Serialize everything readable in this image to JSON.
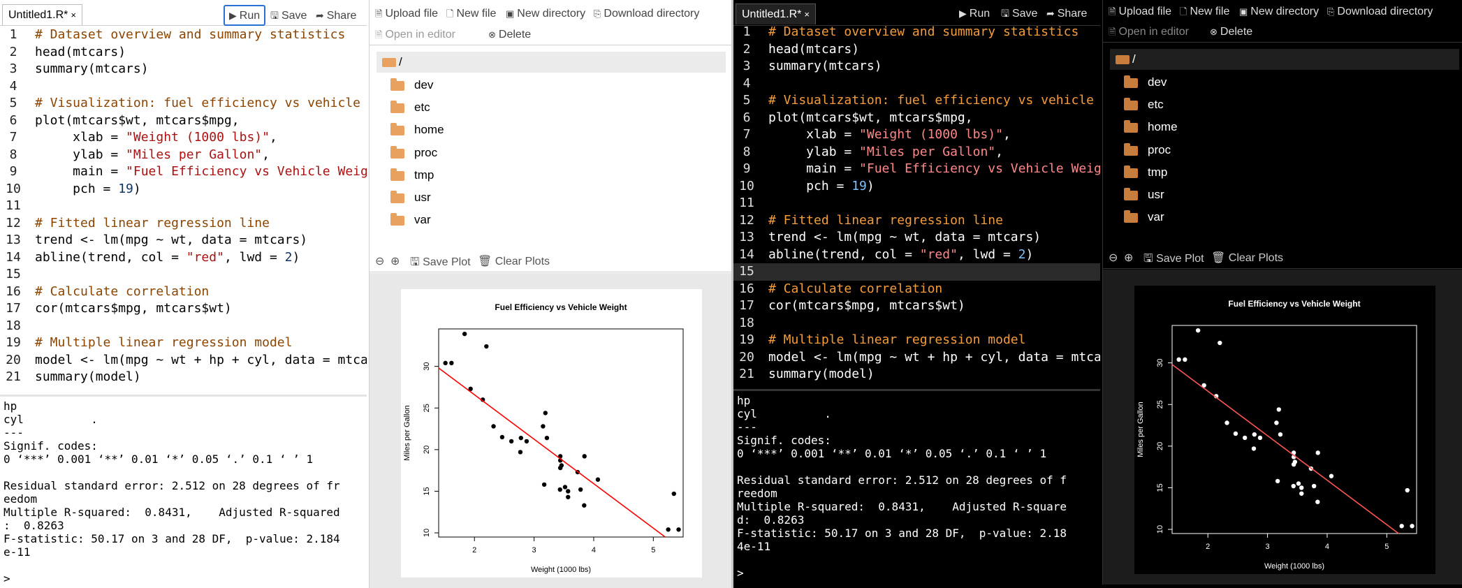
{
  "editor": {
    "tab_label": "Untitled1.R*",
    "tab_close": "×",
    "run_label": "Run",
    "save_label": "Save",
    "share_label": "Share",
    "lines": [
      [
        {
          "t": "# Dataset overview and summary statistics",
          "k": "com"
        }
      ],
      [
        {
          "t": "head(mtcars)"
        }
      ],
      [
        {
          "t": "summary(mtcars)"
        }
      ],
      [
        {
          "t": ""
        }
      ],
      [
        {
          "t": "# Visualization: fuel efficiency vs vehicle weight",
          "k": "com"
        }
      ],
      [
        {
          "t": "plot(mtcars$wt, mtcars$mpg,"
        }
      ],
      [
        {
          "t": "     xlab = "
        },
        {
          "t": "\"Weight (1000 lbs)\"",
          "k": "str"
        },
        {
          "t": ","
        }
      ],
      [
        {
          "t": "     ylab = "
        },
        {
          "t": "\"Miles per Gallon\"",
          "k": "str"
        },
        {
          "t": ","
        }
      ],
      [
        {
          "t": "     main = "
        },
        {
          "t": "\"Fuel Efficiency vs Vehicle Weight\"",
          "k": "str"
        },
        {
          "t": ","
        }
      ],
      [
        {
          "t": "     pch = "
        },
        {
          "t": "19",
          "k": "num"
        },
        {
          "t": ")"
        }
      ],
      [
        {
          "t": ""
        }
      ],
      [
        {
          "t": "# Fitted linear regression line",
          "k": "com"
        }
      ],
      [
        {
          "t": "trend <- lm(mpg ~ wt, data = mtcars)"
        }
      ],
      [
        {
          "t": "abline(trend, col = "
        },
        {
          "t": "\"red\"",
          "k": "str"
        },
        {
          "t": ", lwd = "
        },
        {
          "t": "2",
          "k": "num"
        },
        {
          "t": ")"
        }
      ],
      [
        {
          "t": ""
        }
      ],
      [
        {
          "t": "# Calculate correlation",
          "k": "com"
        }
      ],
      [
        {
          "t": "cor(mtcars$mpg, mtcars$wt)"
        }
      ],
      [
        {
          "t": ""
        }
      ],
      [
        {
          "t": "# Multiple linear regression model",
          "k": "com"
        }
      ],
      [
        {
          "t": "model <- lm(mpg ~ wt + hp + cyl, data = mtcars)"
        }
      ],
      [
        {
          "t": "summary(model)"
        }
      ]
    ]
  },
  "console_light": {
    "lines": [
      "hp",
      "cyl          .",
      "---",
      "Signif. codes:",
      "0 ‘***’ 0.001 ‘**’ 0.01 ‘*’ 0.05 ‘.’ 0.1 ‘ ’ 1",
      "",
      "Residual standard error: 2.512 on 28 degrees of fr",
      "eedom",
      "Multiple R-squared:  0.8431,    Adjusted R-squared",
      ":  0.8263",
      "F-statistic: 50.17 on 3 and 28 DF,  p-value: 2.184",
      "e-11",
      "",
      ">"
    ]
  },
  "console_dark": {
    "lines": [
      "hp",
      "cyl          .",
      "---",
      "Signif. codes:",
      "0 ‘***’ 0.001 ‘**’ 0.01 ‘*’ 0.05 ‘.’ 0.1 ‘ ’ 1",
      "",
      "Residual standard error: 2.512 on 28 degrees of f",
      "reedom",
      "Multiple R-squared:  0.8431,    Adjusted R-square",
      "d:  0.8263",
      "F-statistic: 50.17 on 3 and 28 DF,  p-value: 2.18",
      "4e-11",
      "",
      ">"
    ]
  },
  "files": {
    "upload_label": "Upload file",
    "new_file_label": "New file",
    "new_dir_label": "New directory",
    "download_dir_label": "Download directory",
    "open_editor_label": "Open in editor",
    "delete_label": "Delete",
    "root": "/",
    "folders": [
      "dev",
      "etc",
      "home",
      "proc",
      "tmp",
      "usr",
      "var"
    ]
  },
  "plots": {
    "save_label": "Save Plot",
    "clear_label": "Clear Plots"
  },
  "colors": {
    "light_bg": "#ffffff",
    "dark_bg": "#000000",
    "accent": "#2a6fd6",
    "regression_line": "#ff0000",
    "folder": "#e8a15e"
  },
  "chart_data": {
    "type": "scatter",
    "title": "Fuel Efficiency vs Vehicle Weight",
    "xlabel": "Weight (1000 lbs)",
    "ylabel": "Miles per Gallon",
    "xlim": [
      1.4,
      5.5
    ],
    "ylim": [
      9.5,
      34.5
    ],
    "xticks": [
      2,
      3,
      4,
      5
    ],
    "yticks": [
      10,
      15,
      20,
      25,
      30
    ],
    "points": [
      [
        2.62,
        21.0
      ],
      [
        2.875,
        21.0
      ],
      [
        2.32,
        22.8
      ],
      [
        3.215,
        21.4
      ],
      [
        3.44,
        18.7
      ],
      [
        3.46,
        18.1
      ],
      [
        3.57,
        14.3
      ],
      [
        3.19,
        24.4
      ],
      [
        3.15,
        22.8
      ],
      [
        3.44,
        19.2
      ],
      [
        3.44,
        17.8
      ],
      [
        4.07,
        16.4
      ],
      [
        3.73,
        17.3
      ],
      [
        3.78,
        15.2
      ],
      [
        5.25,
        10.4
      ],
      [
        5.424,
        10.4
      ],
      [
        5.345,
        14.7
      ],
      [
        2.2,
        32.4
      ],
      [
        1.615,
        30.4
      ],
      [
        1.835,
        33.9
      ],
      [
        2.465,
        21.5
      ],
      [
        3.52,
        15.5
      ],
      [
        3.435,
        15.2
      ],
      [
        3.84,
        13.3
      ],
      [
        3.845,
        19.2
      ],
      [
        1.935,
        27.3
      ],
      [
        2.14,
        26.0
      ],
      [
        1.513,
        30.4
      ],
      [
        3.17,
        15.8
      ],
      [
        2.77,
        19.7
      ],
      [
        3.57,
        15.0
      ],
      [
        2.78,
        21.4
      ]
    ],
    "regression": {
      "intercept": 37.285,
      "slope": -5.344,
      "color": "#ff0000"
    }
  }
}
